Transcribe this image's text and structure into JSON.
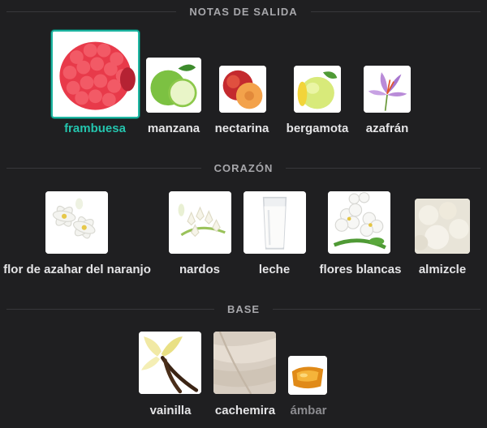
{
  "sections": {
    "top": {
      "title": "NOTAS DE SALIDA",
      "notes": [
        {
          "label": "frambuesa",
          "icon": "raspberry-icon",
          "selected": true
        },
        {
          "label": "manzana",
          "icon": "apple-icon"
        },
        {
          "label": "nectarina",
          "icon": "nectarine-icon"
        },
        {
          "label": "bergamota",
          "icon": "bergamot-icon"
        },
        {
          "label": "azafrán",
          "icon": "saffron-icon"
        }
      ]
    },
    "heart": {
      "title": "CORAZÓN",
      "notes": [
        {
          "label": "flor de azahar del naranjo",
          "icon": "orange-blossom-icon"
        },
        {
          "label": "nardos",
          "icon": "tuberose-icon"
        },
        {
          "label": "leche",
          "icon": "milk-icon"
        },
        {
          "label": "flores blancas",
          "icon": "white-flowers-icon"
        },
        {
          "label": "almizcle",
          "icon": "musk-icon"
        }
      ]
    },
    "base": {
      "title": "BASE",
      "notes": [
        {
          "label": "vainilla",
          "icon": "vanilla-icon"
        },
        {
          "label": "cachemira",
          "icon": "cashmere-icon"
        },
        {
          "label": "ámbar",
          "icon": "amber-icon",
          "dimmed": true
        }
      ]
    }
  },
  "colors": {
    "background": "#1f1f21",
    "accent": "#24c4ad",
    "label": "#e4e4e6",
    "section_title": "#a7a7ab"
  }
}
